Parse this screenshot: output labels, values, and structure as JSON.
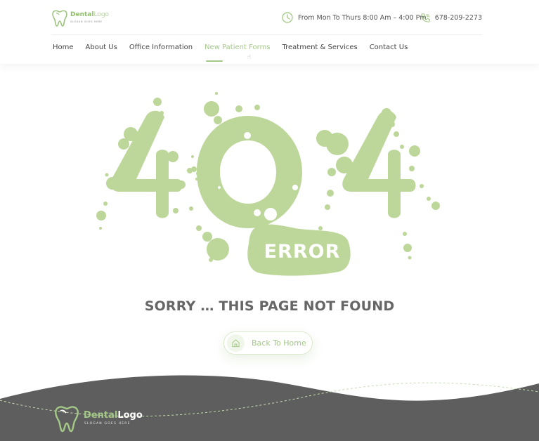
{
  "header": {
    "logo": {
      "brand_part1": "Dental",
      "brand_part2": "Logo",
      "slogan": "SLOGAN GOES HERE"
    },
    "hours": "From Mon To Thurs 8:00 Am – 4:00 Pm",
    "phone": "678-209-2273",
    "nav": [
      {
        "label": "Home",
        "active": false
      },
      {
        "label": "About Us",
        "active": false
      },
      {
        "label": "Office Information",
        "active": false
      },
      {
        "label": "New Patient Forms",
        "active": true
      },
      {
        "label": "Treatment & Services",
        "active": false
      },
      {
        "label": "Contact Us",
        "active": false
      }
    ]
  },
  "main": {
    "error_code": "404",
    "error_word": "ERROR",
    "title": "SORRY … THIS PAGE NOT FOUND",
    "button_label": "Back To Home"
  },
  "footer": {
    "logo": {
      "brand_part1": "Dental",
      "brand_part2": "Logo",
      "slogan": "SLOGAN GOES HERE"
    }
  },
  "colors": {
    "accent": "#a3c887",
    "splash": "#bdd69a",
    "footer_bg": "#5e5e5e",
    "title": "#666666"
  },
  "icons": [
    "tooth-logo-icon",
    "clock-icon",
    "phone-icon",
    "home-icon",
    "pointer-cursor-icon"
  ]
}
